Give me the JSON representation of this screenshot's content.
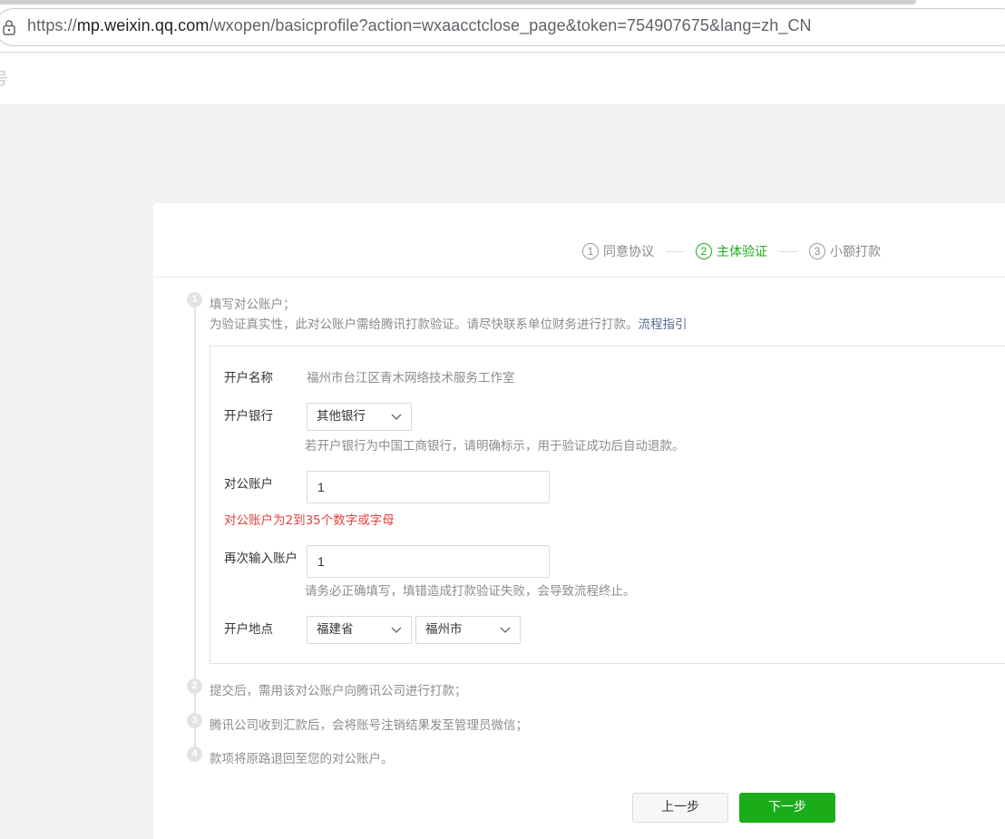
{
  "browser": {
    "url_scheme": "https://",
    "url_host": "mp.weixin.qq.com",
    "url_path": "/wxopen/basicprofile?action=wxaacctclose_page&token=754907675&lang=zh_CN"
  },
  "header": {
    "cut_text": "号"
  },
  "steps": [
    {
      "num": "1",
      "label": "同意协议",
      "active": false
    },
    {
      "num": "2",
      "label": "主体验证",
      "active": true
    },
    {
      "num": "3",
      "label": "小额打款",
      "active": false
    }
  ],
  "process": {
    "step1_title": "填写对公账户；",
    "step1_desc": "为验证真实性，此对公账户需给腾讯打款验证。请尽快联系单位财务进行打款。",
    "step1_link": "流程指引",
    "step2": "提交后，需用该对公账户向腾讯公司进行打款；",
    "step3": "腾讯公司收到汇款后，会将账号注销结果发至管理员微信；",
    "step4": "款项将原路退回至您的对公账户。",
    "dots": [
      "1",
      "2",
      "3",
      "4"
    ]
  },
  "form": {
    "account_name_label": "开户名称",
    "account_name_value": "福州市台江区青木网络技术服务工作室",
    "bank_label": "开户银行",
    "bank_selected": "其他银行",
    "bank_hint": "若开户银行为中国工商银行，请明确标示，用于验证成功后自动退款。",
    "account_label": "对公账户",
    "account_value": "1",
    "account_error": "对公账户为2到35个数字或字母",
    "confirm_label": "再次输入账户",
    "confirm_value": "1",
    "confirm_hint": "请务必正确填写，填错造成打款验证失败，会导致流程终止。",
    "location_label": "开户地点",
    "province_selected": "福建省",
    "city_selected": "福州市"
  },
  "buttons": {
    "prev": "上一步",
    "next": "下一步"
  },
  "colors": {
    "accent_green": "#1aad19",
    "error_red": "#e64340",
    "link_blue": "#576b95"
  }
}
